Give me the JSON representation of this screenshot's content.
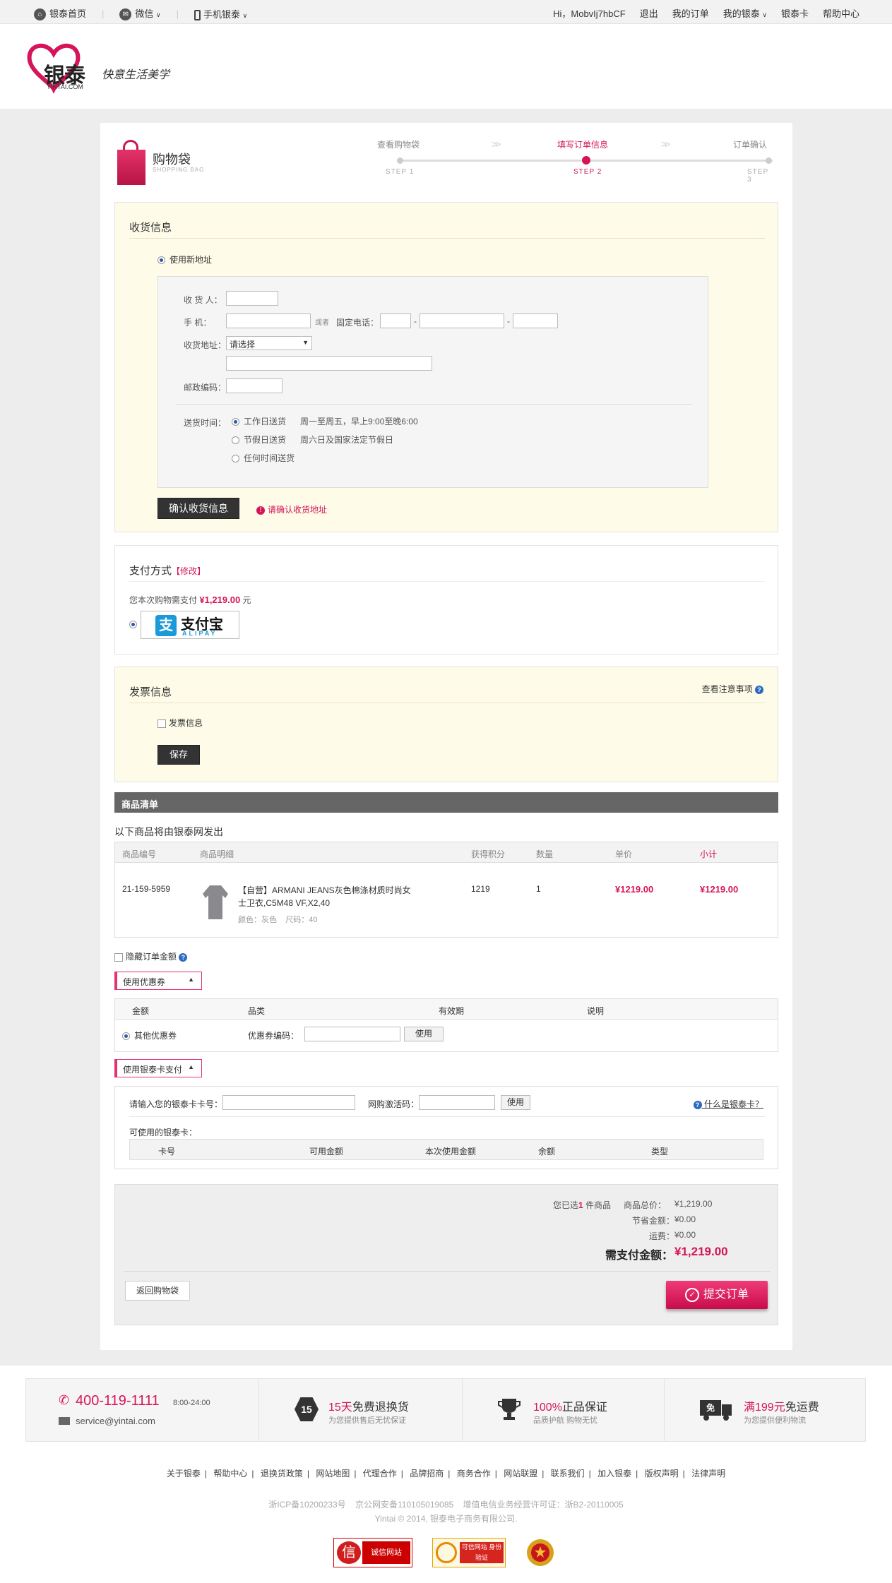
{
  "topbar": {
    "home": "银泰首页",
    "wechat": "微信",
    "mobile": "手机银泰",
    "greeting": "Hi，MobvIj7hbCF",
    "logout": "退出",
    "my_orders": "我的订单",
    "my_yintai": "我的银泰",
    "card": "银泰卡",
    "help": "帮助中心"
  },
  "logo": {
    "brand": "银泰",
    "domain": "YINTAI.COM",
    "slogan": "快意生活美学"
  },
  "bag": {
    "title": "购物袋",
    "subtitle": "SHOPPING BAG"
  },
  "steps": [
    {
      "label": "查看购物袋",
      "num": "STEP 1",
      "active": false
    },
    {
      "label": "填写订单信息",
      "num": "STEP 2",
      "active": true
    },
    {
      "label": "订单确认",
      "num": "STEP 3",
      "active": false
    }
  ],
  "shipping": {
    "title": "收货信息",
    "new_address": "使用新地址",
    "recipient_label": "收  货 人：",
    "mobile_label": "手      机：",
    "or_text": "或者",
    "phone_label": "固定电话：",
    "address_label": "收货地址：",
    "address_select": "请选择",
    "zip_label": "邮政编码：",
    "delivery_label": "送货时间：",
    "delivery_options": [
      {
        "label": "工作日送货",
        "desc": "周一至周五，早上9:00至晚6:00",
        "selected": true
      },
      {
        "label": "节假日送货",
        "desc": "周六日及国家法定节假日",
        "selected": false
      },
      {
        "label": "任何时间送货",
        "desc": "",
        "selected": false
      }
    ],
    "confirm_button": "确认收货信息",
    "warning": "请确认收货地址"
  },
  "payment": {
    "title": "支付方式",
    "modify": "【修改】",
    "amount_prefix": "您本次购物需支付",
    "amount": "¥1,219.00",
    "amount_suffix": "元",
    "alipay_cn": "支付宝",
    "alipay_en": "ALIPAY"
  },
  "invoice": {
    "title": "发票信息",
    "notes_link": "查看注意事项",
    "checkbox_label": "发票信息",
    "save_button": "保存"
  },
  "goods": {
    "bar_title": "商品清单",
    "ship_from": "以下商品将由银泰网发出",
    "headers": [
      "商品编号",
      "商品明细",
      "获得积分",
      "数量",
      "单价",
      "小计"
    ],
    "rows": [
      {
        "sku": "21-159-5959",
        "name": "【自营】ARMANI JEANS灰色棉涤材质时尚女士卫衣,C5M48 VF,X2,40",
        "attrs": "颜色：灰色    尺码：40",
        "points": "1219",
        "qty": "1",
        "price": "¥1219.00",
        "subtotal": "¥1219.00"
      }
    ]
  },
  "hide_amount": "隐藏订单金额",
  "coupon": {
    "toggle": "使用优惠券",
    "headers": [
      "金额",
      "品类",
      "有效期",
      "说明"
    ],
    "other": "其他优惠券",
    "code_label": "优惠券编码：",
    "use_button": "使用"
  },
  "yintai_card": {
    "toggle": "使用银泰卡支付",
    "card_label": "请输入您的银泰卡卡号：",
    "pass_label": "网购激活码：",
    "use_button": "使用",
    "what_link": "什么是银泰卡？",
    "available": "可使用的银泰卡：",
    "headers": [
      "卡号",
      "可用金额",
      "本次使用金额",
      "余额",
      "类型"
    ]
  },
  "summary": {
    "selected_prefix": "您已选",
    "selected_count": "1",
    "selected_suffix": "件商品",
    "total_label": "商品总价：",
    "total": "¥1,219.00",
    "saved_label": "节省金额：",
    "saved": "¥0.00",
    "shipping_label": "运费：",
    "shipping": "¥0.00",
    "pay_label": "需支付金额：",
    "pay": "¥1,219.00",
    "back_button": "返回购物袋",
    "submit_button": "提交订单"
  },
  "footer": {
    "phone": "400-119-1111",
    "hours": "8:00-24:00",
    "email": "service@yintai.com",
    "promises": [
      {
        "badge": "15",
        "highlight": "15天",
        "title": "免费退换货",
        "sub": "为您提供售后无忧保证"
      },
      {
        "badge": "",
        "highlight": "100%",
        "title": "正品保证",
        "sub": "品质护航 购物无忧"
      },
      {
        "badge": "免",
        "highlight": "满199元",
        "title": "免运费",
        "sub": "为您提供便利物流"
      }
    ],
    "links": [
      "关于银泰",
      "帮助中心",
      "退换货政策",
      "网站地图",
      "代理合作",
      "品牌招商",
      "商务合作",
      "网站联盟",
      "联系我们",
      "加入银泰",
      "版权声明",
      "法律声明"
    ],
    "icp": "浙ICP备10200233号    京公网安备110105019085    增值电信业务经营许可证：浙B2-20110005",
    "copyright": "Yintai © 2014, 银泰电子商务有限公司.",
    "badges": [
      "诚信网站",
      "可信网站 身份验证"
    ]
  }
}
